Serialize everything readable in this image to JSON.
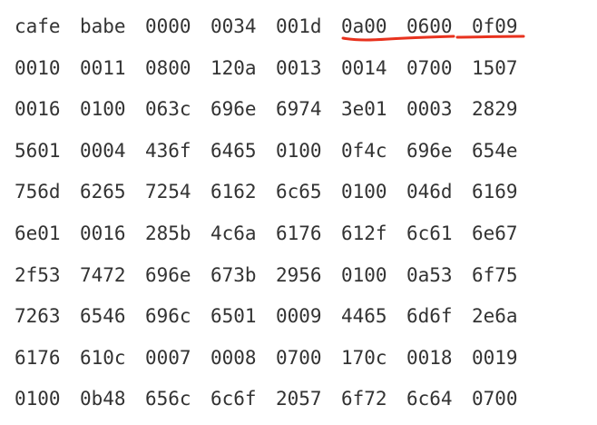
{
  "hex_dump": {
    "rows": [
      [
        "cafe",
        "babe",
        "0000",
        "0034",
        "001d",
        "0a00",
        "0600",
        "0f09"
      ],
      [
        "0010",
        "0011",
        "0800",
        "120a",
        "0013",
        "0014",
        "0700",
        "1507"
      ],
      [
        "0016",
        "0100",
        "063c",
        "696e",
        "6974",
        "3e01",
        "0003",
        "2829"
      ],
      [
        "5601",
        "0004",
        "436f",
        "6465",
        "0100",
        "0f4c",
        "696e",
        "654e"
      ],
      [
        "756d",
        "6265",
        "7254",
        "6162",
        "6c65",
        "0100",
        "046d",
        "6169"
      ],
      [
        "6e01",
        "0016",
        "285b",
        "4c6a",
        "6176",
        "612f",
        "6c61",
        "6e67"
      ],
      [
        "2f53",
        "7472",
        "696e",
        "673b",
        "2956",
        "0100",
        "0a53",
        "6f75"
      ],
      [
        "7263",
        "6546",
        "696c",
        "6501",
        "0009",
        "4465",
        "6d6f",
        "2e6a"
      ],
      [
        "6176",
        "610c",
        "0007",
        "0008",
        "0700",
        "170c",
        "0018",
        "0019"
      ],
      [
        "0100",
        "0b48",
        "656c",
        "6c6f",
        "2057",
        "6f72",
        "6c64",
        "0700"
      ]
    ]
  },
  "annotation": {
    "color": "#e8321e"
  }
}
